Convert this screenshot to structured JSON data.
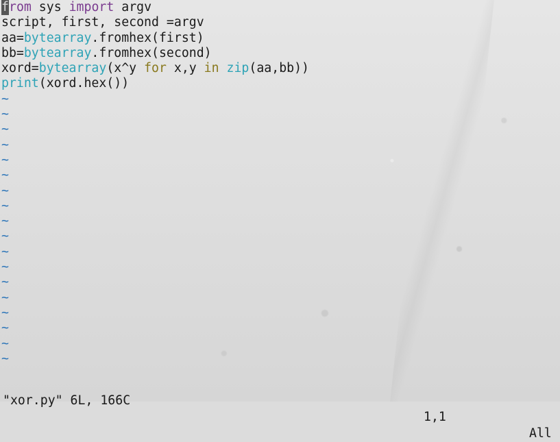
{
  "editor": {
    "code": {
      "l1": {
        "cursor_char": "f",
        "kw_from_rest": "rom",
        "text_a": " sys ",
        "kw_import": "import",
        "text_b": " argv"
      },
      "l2": {
        "text": "script, first, second =argv"
      },
      "l3": {
        "a": "aa=",
        "fn": "bytearray",
        "b": ".fromhex(first)"
      },
      "l4": {
        "a": "bb=",
        "fn": "bytearray",
        "b": ".fromhex(second)"
      },
      "l5": {
        "a": "xord=",
        "fn": "bytearray",
        "b": "(x^y ",
        "kw_for": "for",
        "c": " x,y ",
        "kw_in": "in",
        "d": " ",
        "fn_zip": "zip",
        "e": "(aa,bb))"
      },
      "l6": {
        "fn_print": "print",
        "a": "(xord.hex())"
      }
    },
    "tilde": "~"
  },
  "status": {
    "file_info": "\"xor.py\" 6L, 166C",
    "position": "1,1",
    "scroll": "All"
  },
  "colors": {
    "keyword": "#7a3b8f",
    "builtin": "#2ea3b6",
    "control": "#8a7a1f",
    "tilde": "#2b74b8"
  }
}
